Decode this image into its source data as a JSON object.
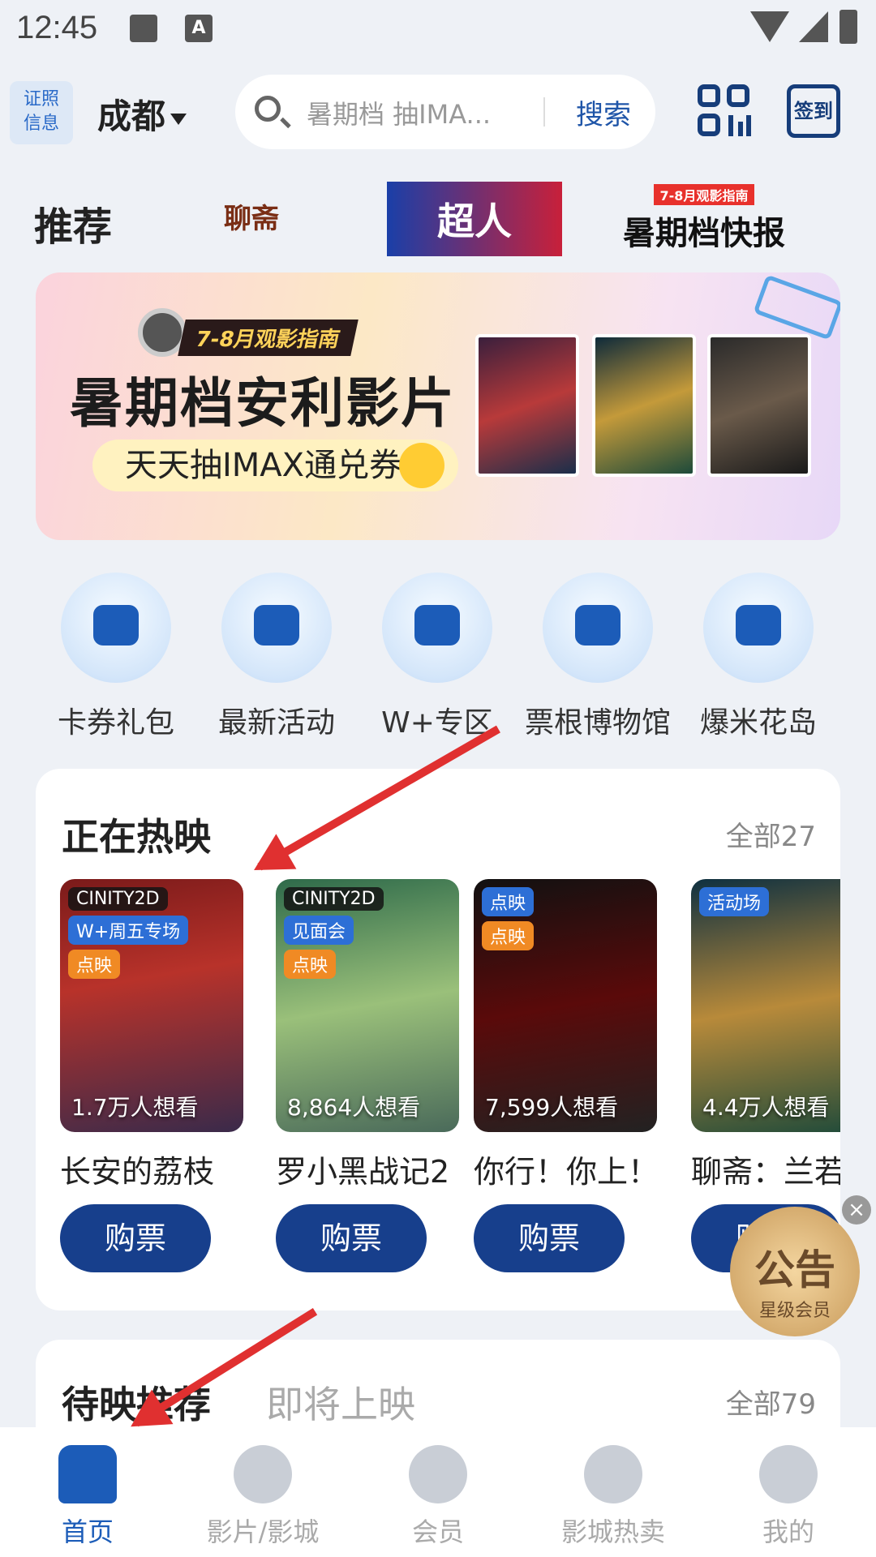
{
  "status_bar": {
    "time": "12:45"
  },
  "header": {
    "cert_info": "证照\n信息",
    "city": "成都",
    "search_placeholder": "暑期档 抽IMA...",
    "search_button": "搜索",
    "checkin_label": "签到"
  },
  "recommend": {
    "title": "推荐",
    "logos": [
      "聊斋",
      "超人",
      "暑期档快报"
    ],
    "logo3_tag": "7-8月观影指南"
  },
  "banner": {
    "tag": "7-8月观影指南",
    "headline": "暑期档安利影片",
    "subline": "天天抽IMAX通兑券"
  },
  "quick_links": [
    {
      "label": "卡券礼包",
      "icon": "ticket-icon"
    },
    {
      "label": "最新活动",
      "icon": "gift-icon"
    },
    {
      "label": "W+专区",
      "icon": "crown-icon"
    },
    {
      "label": "票根博物馆",
      "icon": "museum-icon"
    },
    {
      "label": "爆米花岛",
      "icon": "corn-icon"
    }
  ],
  "now_showing": {
    "title": "正在热映",
    "all_label": "全部27",
    "buy_label": "购票",
    "movies": [
      {
        "title": "长安的荔枝",
        "want": "1.7万人想看",
        "badges": [
          "CINITY2D",
          "W+周五专场",
          "点映"
        ]
      },
      {
        "title": "罗小黑战记2",
        "want": "8,864人想看",
        "badges": [
          "CINITY2D",
          "见面会",
          "点映"
        ]
      },
      {
        "title": "你行！你上！",
        "want": "7,599人想看",
        "badges": [
          "点映",
          "点映"
        ]
      },
      {
        "title": "聊斋：兰若",
        "want": "4.4万人想看",
        "badges": [
          "活动场"
        ]
      }
    ]
  },
  "notice": {
    "title": "公告",
    "subtitle": "星级会员"
  },
  "upcoming": {
    "title": "待映推荐",
    "tab2": "即将上映",
    "all_label": "全部79"
  },
  "tabbar": [
    {
      "label": "首页",
      "icon": "home-icon",
      "active": true
    },
    {
      "label": "影片/影城",
      "icon": "film-reel-icon",
      "active": false
    },
    {
      "label": "会员",
      "icon": "crown-icon",
      "active": false
    },
    {
      "label": "影城热卖",
      "icon": "popcorn-icon",
      "active": false
    },
    {
      "label": "我的",
      "icon": "smile-icon",
      "active": false
    }
  ],
  "colors": {
    "brand": "#173f8c",
    "accent": "#1c5cb8",
    "arrow": "#e03030"
  }
}
